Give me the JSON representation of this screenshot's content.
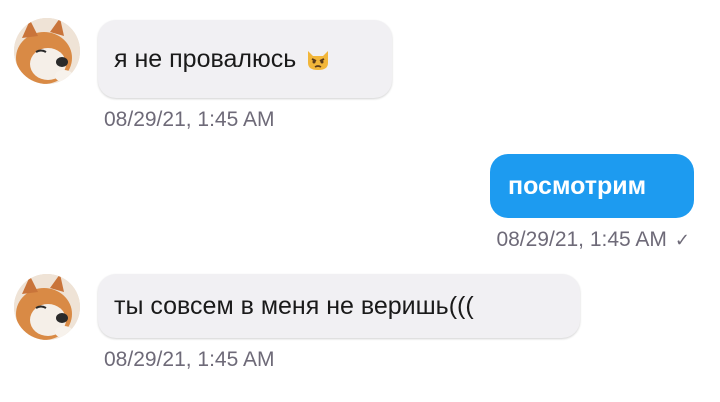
{
  "messages": [
    {
      "direction": "incoming",
      "text": "я не провалюсь",
      "emoji": "pouting-cat-emoji",
      "timestamp": "08/29/21, 1:45 AM"
    },
    {
      "direction": "outgoing",
      "text": "посмотрим",
      "timestamp": "08/29/21, 1:45 AM",
      "status_icon": "check-icon"
    },
    {
      "direction": "incoming",
      "text": "ты совсем в меня не веришь(((",
      "timestamp": "08/29/21, 1:45 AM"
    }
  ],
  "colors": {
    "outgoing_bubble": "#1d9bf0",
    "incoming_bubble": "#f1f0f3",
    "timestamp": "#6e6a78"
  }
}
